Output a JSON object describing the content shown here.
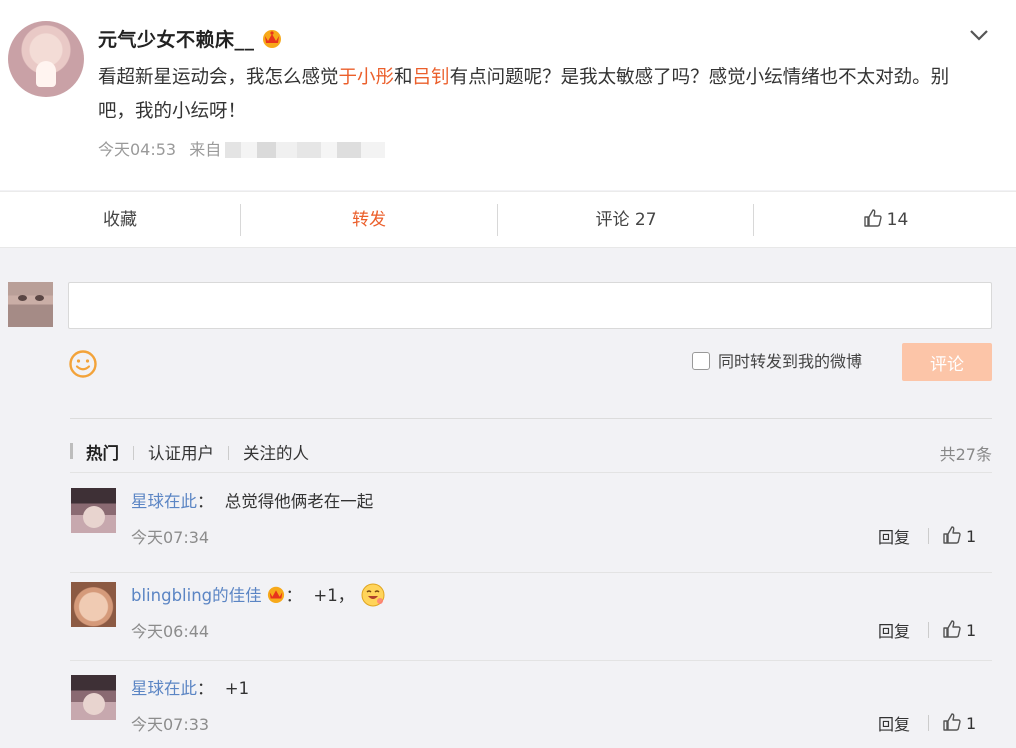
{
  "post": {
    "username": "元气少女不赖床__",
    "text_parts": [
      "看超新星运动会，我怎么感觉",
      "于小彤",
      "和",
      "吕钊",
      "有点问题呢？是我太敏感了吗？感觉小纭情绪也不太对劲。别吧，我的小纭呀！"
    ],
    "time": "今天04:53",
    "source_prefix": "来自"
  },
  "actions": {
    "favorite": "收藏",
    "repost": "转发",
    "comment": "评论 27",
    "likes": "14"
  },
  "composer": {
    "placeholder": "",
    "repost_option": "同时转发到我的微博",
    "submit": "评论"
  },
  "tabs": {
    "hot": "热门",
    "verified": "认证用户",
    "following": "关注的人",
    "total": "共27条"
  },
  "comments": [
    {
      "name": "星球在此",
      "sep": "：",
      "text": "总觉得他俩老在一起",
      "time": "今天07:34",
      "reply": "回复",
      "likes": "1"
    },
    {
      "name": "blingbling的佳佳",
      "sep": "：",
      "text": "+1，",
      "time": "今天06:44",
      "reply": "回复",
      "likes": "1"
    },
    {
      "name": "星球在此",
      "sep": "：",
      "text": "+1",
      "time": "今天07:33",
      "reply": "回复",
      "likes": "1"
    }
  ],
  "colors": {
    "accent": "#eb5f2b",
    "link": "#5b85c4",
    "button_disabled": "#fcc5a8"
  },
  "icons": {
    "header": [
      "crown-icon",
      "chevron-down-icon"
    ],
    "actions": [
      "thumbs-up-icon"
    ],
    "composer": [
      "smile-icon",
      "checkbox"
    ],
    "comments": [
      "thumbs-up-icon",
      "laughing-emoji-icon"
    ]
  }
}
